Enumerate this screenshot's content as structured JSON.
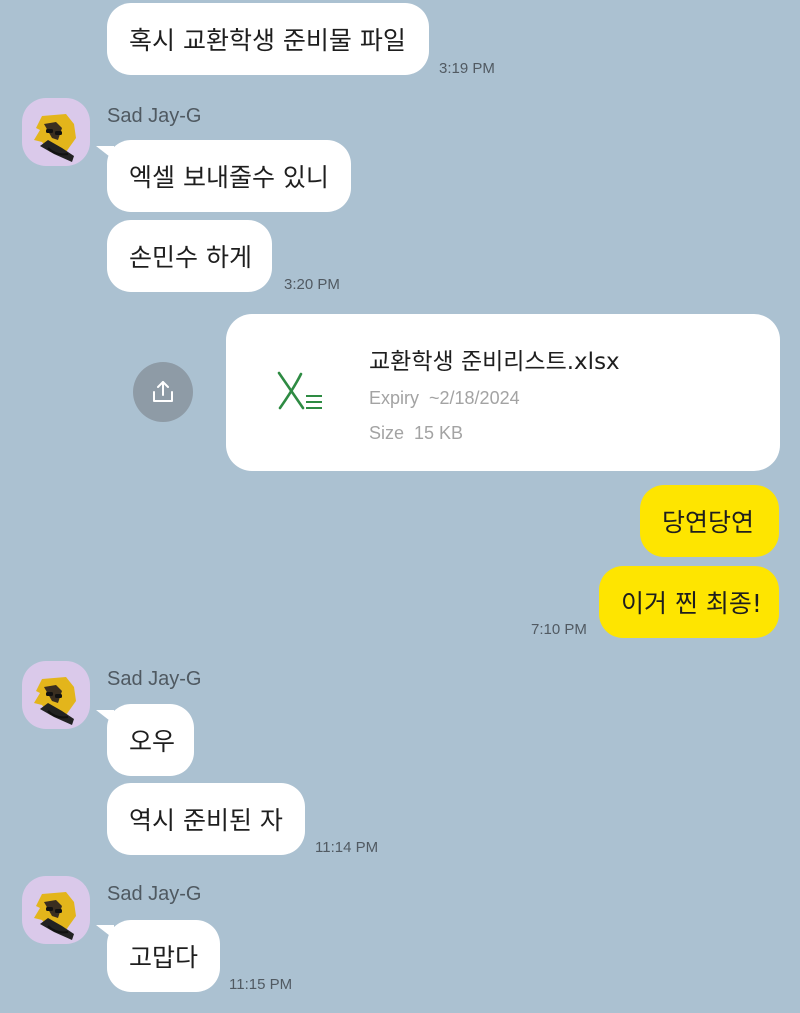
{
  "colors": {
    "background": "#abc1d1",
    "incoming_bubble": "#ffffff",
    "outgoing_bubble": "#fee500",
    "avatar_bg": "#dac9ea",
    "excel_green": "#2e8b43"
  },
  "messages": [
    {
      "side": "incoming",
      "text": "혹시 교환학생 준비물 파일",
      "time": "3:19 PM"
    },
    {
      "side": "incoming",
      "sender": "Sad Jay-G",
      "avatar_icon": "character-avatar-icon",
      "text": "엑셀 보내줄수 있니"
    },
    {
      "side": "incoming",
      "text": "손민수 하게",
      "time": "3:20 PM"
    },
    {
      "side": "outgoing",
      "type": "file",
      "file": {
        "name": "교환학생 준비리스트.xlsx",
        "expiry_label": "Expiry",
        "expiry_value": "~2/18/2024",
        "size_label": "Size",
        "size_value": "15 KB",
        "icon": "excel-file-icon"
      },
      "share_icon": "share-upload-icon"
    },
    {
      "side": "outgoing",
      "text": "당연당연"
    },
    {
      "side": "outgoing",
      "text": "이거 찐 최종!",
      "time": "7:10 PM"
    },
    {
      "side": "incoming",
      "sender": "Sad Jay-G",
      "text": "오우"
    },
    {
      "side": "incoming",
      "text": "역시 준비된 자",
      "time": "11:14 PM"
    },
    {
      "side": "incoming",
      "sender": "Sad Jay-G",
      "text": "고맙다",
      "time": "11:15 PM"
    }
  ]
}
